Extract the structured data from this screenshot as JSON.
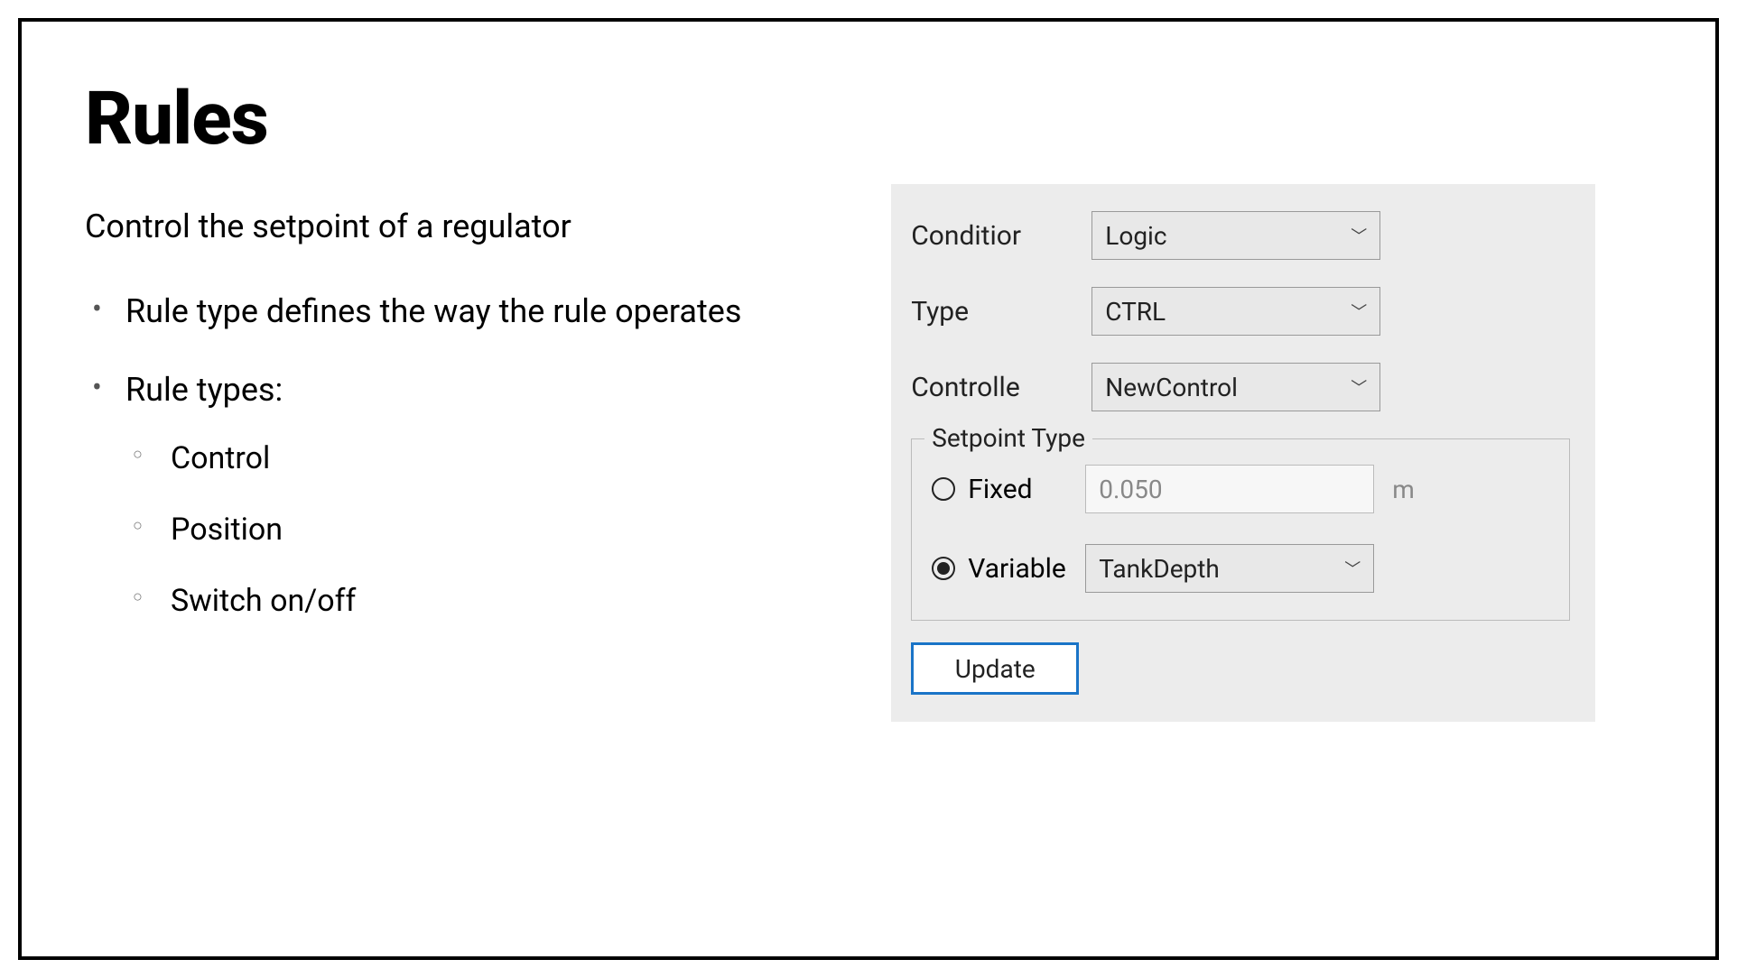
{
  "title": "Rules",
  "subtitle": "Control the setpoint of a regulator",
  "bullets": {
    "b1": "Rule type defines the way the rule operates",
    "b2": "Rule types:",
    "sub": {
      "s1": "Control",
      "s2": "Position",
      "s3": "Switch on/off"
    }
  },
  "panel": {
    "condition_label": "Conditior",
    "condition_value": "Logic",
    "type_label": "Type",
    "type_value": "CTRL",
    "controller_label": "Controlle",
    "controller_value": "NewControl",
    "setpoint_legend": "Setpoint Type",
    "fixed_label": "Fixed",
    "fixed_value": "0.050",
    "fixed_unit": "m",
    "variable_label": "Variable",
    "variable_value": "TankDepth",
    "update_label": "Update"
  }
}
